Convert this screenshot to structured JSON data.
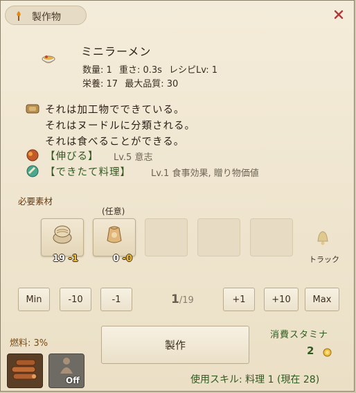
{
  "window": {
    "title": "製作物",
    "close_icon": "close-icon"
  },
  "item": {
    "name": "ミニラーメン",
    "stats_line1": [
      "数量: 1",
      "重さ: 0.3s",
      "レシピLv: 1"
    ],
    "stats_line2": [
      "栄養: 17",
      "最大品質: 30"
    ]
  },
  "description": [
    "それは加工物でできている。",
    "それはヌードルに分類される。",
    "それは食べることができる。"
  ],
  "traits": [
    {
      "name": "【伸びる】",
      "detail": "Lv.5 意志",
      "icon": "stretch-trait-icon"
    },
    {
      "name": "【できたて料理】",
      "detail": "Lv.1 食事効果, 贈り物価値",
      "icon": "fresh-dish-trait-icon"
    }
  ],
  "materials": {
    "label": "必要素材",
    "optional_label": "(任意)",
    "slots": [
      {
        "have": "19",
        "need": "-1",
        "icon": "noodle-bundle-icon"
      },
      {
        "have": "0",
        "need": "-0",
        "icon": "flour-sack-icon"
      }
    ],
    "track_label": "トラック"
  },
  "controls": {
    "min": "Min",
    "minus10": "-10",
    "minus1": "-1",
    "count": "1",
    "count_max": "/19",
    "plus1": "+1",
    "plus10": "+10",
    "max": "Max"
  },
  "fuel": {
    "label": "燃料: 3%",
    "off_label": "Off"
  },
  "craft_button": "製作",
  "stamina": {
    "label": "消費スタミナ",
    "value": "2"
  },
  "skill": "使用スキル: 料理 1 (現在 28)",
  "colors": {
    "trait_green": "#2f5a1f",
    "label_brown": "#6a3b12",
    "shortage_yellow": "#f0c030"
  }
}
